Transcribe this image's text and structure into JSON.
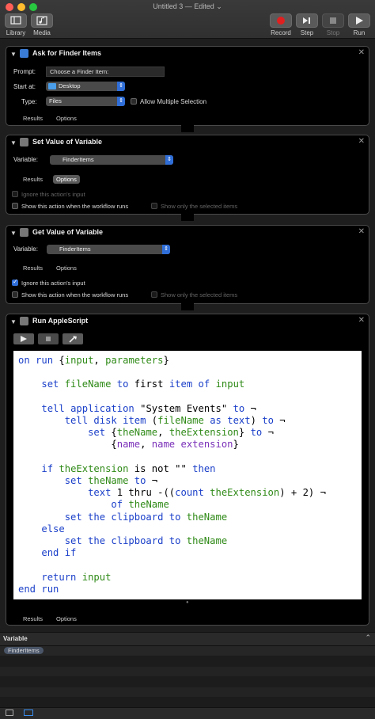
{
  "window": {
    "title": "Untitled 3 — Edited ⌄"
  },
  "toolbar": {
    "library_label": "Library",
    "media_label": "Media",
    "record_label": "Record",
    "step_label": "Step",
    "stop_label": "Stop",
    "run_label": "Run"
  },
  "ask": {
    "title": "Ask for Finder Items",
    "prompt_label": "Prompt:",
    "prompt_value": "Choose a Finder Item:",
    "start_label": "Start at:",
    "start_value": "Desktop",
    "type_label": "Type:",
    "type_value": "Files",
    "allow_multiple": "Allow Multiple Selection",
    "results_tab": "Results",
    "options_tab": "Options"
  },
  "setvar": {
    "title": "Set Value of Variable",
    "variable_label": "Variable:",
    "variable_value": "FinderItems",
    "results_tab": "Results",
    "options_tab": "Options",
    "ignore_input": "Ignore this action's input",
    "show_action": "Show this action when the workflow runs",
    "show_selected": "Show only the selected items"
  },
  "getvar": {
    "title": "Get Value of Variable",
    "variable_label": "Variable:",
    "variable_value": "FinderItems",
    "results_tab": "Results",
    "options_tab": "Options",
    "ignore_input": "Ignore this action's input",
    "show_action": "Show this action when the workflow runs",
    "show_selected": "Show only the selected items"
  },
  "script": {
    "title": "Run AppleScript",
    "results_tab": "Results",
    "options_tab": "Options"
  },
  "variables": {
    "header": "Variable",
    "items": [
      "FinderItems"
    ]
  },
  "colors": {
    "accent": "#2f6ed8",
    "record": "#e02020"
  },
  "icons": [
    "library-icon",
    "media-icon",
    "record-icon",
    "step-icon",
    "stop-icon",
    "run-icon",
    "run-script-icon",
    "stop-script-icon",
    "compile-icon"
  ]
}
